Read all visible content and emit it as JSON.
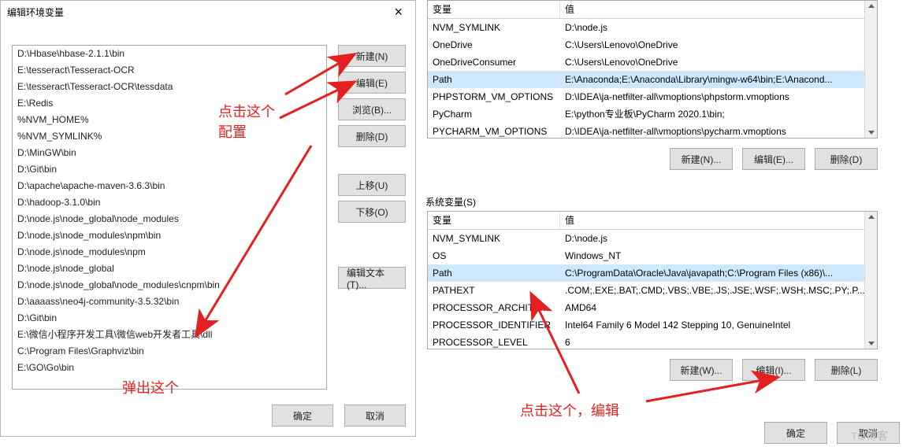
{
  "left_dialog": {
    "title": "编辑环境变量",
    "paths": [
      "D:\\Hbase\\hbase-2.1.1\\bin",
      "E:\\tesseract\\Tesseract-OCR",
      "E:\\tesseract\\Tesseract-OCR\\tessdata",
      "E:\\Redis",
      "%NVM_HOME%",
      "%NVM_SYMLINK%",
      "D:\\MinGW\\bin",
      "D:\\Git\\bin",
      "D:\\apache\\apache-maven-3.6.3\\bin",
      "D:\\hadoop-3.1.0\\bin",
      "D:\\node.js\\node_global\\node_modules",
      "D:\\node.js\\node_modules\\npm\\bin",
      "D:\\node.js\\node_modules\\npm",
      "D:\\node.js\\node_global",
      "D:\\node.js\\node_global\\node_modules\\cnpm\\bin",
      "D:\\aaaass\\neo4j-community-3.5.32\\bin",
      "D:\\Git\\bin",
      "E:\\微信小程序开发工具\\微信web开发者工具\\dll",
      "C:\\Program Files\\Graphviz\\bin",
      "E:\\GO\\Go\\bin"
    ],
    "buttons": {
      "new": "新建(N)",
      "edit": "编辑(E)",
      "browse": "浏览(B)...",
      "delete": "删除(D)",
      "moveUp": "上移(U)",
      "moveDn": "下移(O)",
      "editTxt": "编辑文本(T)...",
      "ok": "确定",
      "cancel": "取消"
    }
  },
  "user_vars": {
    "header_var": "变量",
    "header_val": "值",
    "rows": [
      {
        "var": "NVM_SYMLINK",
        "val": "D:\\node.js"
      },
      {
        "var": "OneDrive",
        "val": "C:\\Users\\Lenovo\\OneDrive"
      },
      {
        "var": "OneDriveConsumer",
        "val": "C:\\Users\\Lenovo\\OneDrive"
      },
      {
        "var": "Path",
        "val": "E:\\Anaconda;E:\\Anaconda\\Library\\mingw-w64\\bin;E:\\Anacond...",
        "selected": true
      },
      {
        "var": "PHPSTORM_VM_OPTIONS",
        "val": "D:\\IDEA\\ja-netfilter-all\\vmoptions\\phpstorm.vmoptions"
      },
      {
        "var": "PyCharm",
        "val": "E:\\python专业板\\PyCharm 2020.1\\bin;"
      },
      {
        "var": "PYCHARM_VM_OPTIONS",
        "val": "D:\\IDEA\\ja-netfilter-all\\vmoptions\\pycharm.vmoptions"
      }
    ],
    "buttons": {
      "new": "新建(N)...",
      "edit": "编辑(E)...",
      "delete": "删除(D)"
    }
  },
  "sys_vars": {
    "section_label": "系统变量(S)",
    "header_var": "变量",
    "header_val": "值",
    "rows": [
      {
        "var": "NVM_SYMLINK",
        "val": "D:\\node.js"
      },
      {
        "var": "OS",
        "val": "Windows_NT"
      },
      {
        "var": "Path",
        "val": "C:\\ProgramData\\Oracle\\Java\\javapath;C:\\Program Files (x86)\\...",
        "selected": true
      },
      {
        "var": "PATHEXT",
        "val": ".COM;.EXE;.BAT;.CMD;.VBS;.VBE;.JS;.JSE;.WSF;.WSH;.MSC;.PY;.P..."
      },
      {
        "var": "PROCESSOR_ARCHITECT...",
        "val": "AMD64"
      },
      {
        "var": "PROCESSOR_IDENTIFIER",
        "val": "Intel64 Family 6 Model 142 Stepping 10, GenuineIntel"
      },
      {
        "var": "PROCESSOR_LEVEL",
        "val": "6"
      }
    ],
    "buttons": {
      "new": "新建(W)...",
      "edit": "编辑(I)...",
      "delete": "删除(L)"
    },
    "final": {
      "ok": "确定",
      "cancel": "取消"
    }
  },
  "annotations": {
    "click_this_config1": "点击这个",
    "click_this_config2": "配置",
    "popup_this": "弹出这个",
    "click_edit": "点击这个，编辑"
  },
  "watermark": "TO博客"
}
